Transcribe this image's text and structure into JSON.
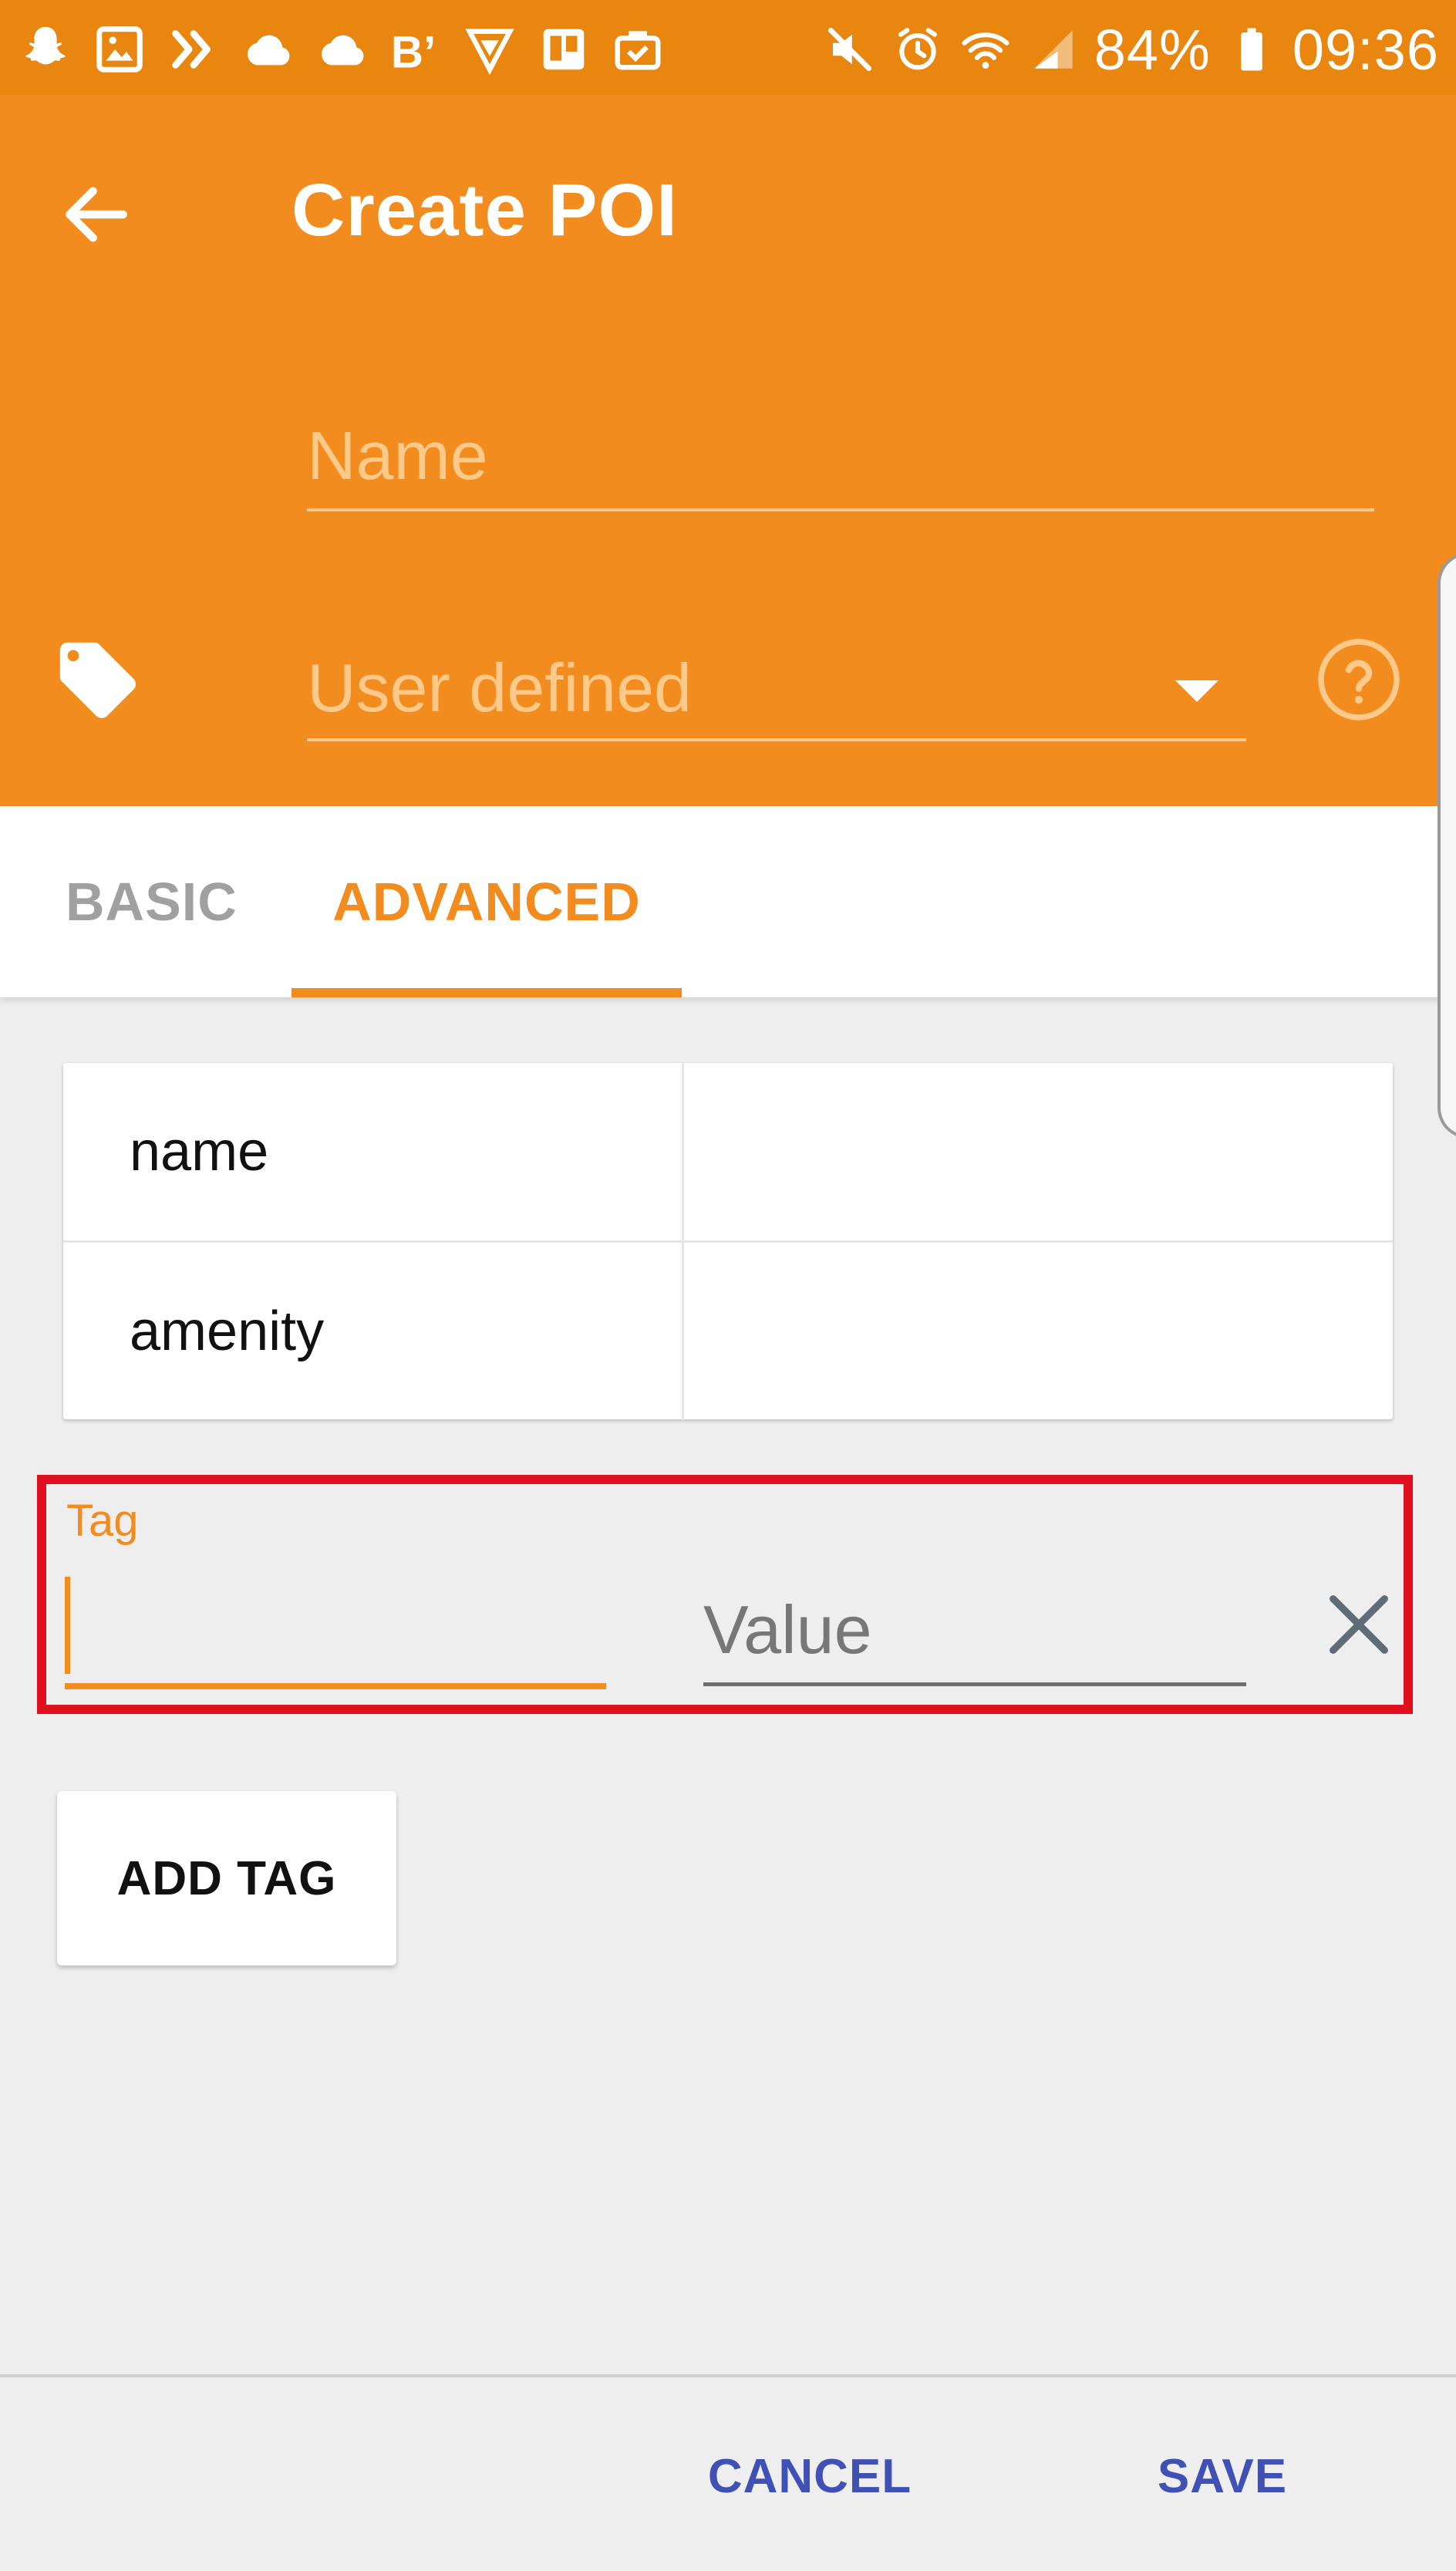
{
  "status_bar": {
    "left_icons": [
      "snapchat-icon",
      "gallery-icon",
      "forward-icon",
      "cloud-icon",
      "cloud-icon",
      "bold-b-icon",
      "triangle-logo-icon",
      "trello-icon",
      "briefcase-icon"
    ],
    "right_icons": [
      "mute-icon",
      "alarm-icon",
      "wifi-icon",
      "signal-icon",
      "battery-icon"
    ],
    "battery_text": "84%",
    "time": "09:36"
  },
  "app_bar": {
    "title": "Create POI",
    "name_placeholder": "Name",
    "type_value": "User defined",
    "back_icon": "arrow-left-icon",
    "tag_icon": "tag-icon",
    "help_icon": "help-circle-icon"
  },
  "tabs": [
    {
      "label": "BASIC",
      "active": false
    },
    {
      "label": "ADVANCED",
      "active": true
    }
  ],
  "tag_table": {
    "rows": [
      {
        "key": "name",
        "value": ""
      },
      {
        "key": "amenity",
        "value": ""
      }
    ]
  },
  "new_tag": {
    "tag_label": "Tag",
    "tag_value": "",
    "value_placeholder": "Value",
    "value_value": ""
  },
  "add_tag_label": "ADD TAG",
  "footer": {
    "cancel_label": "CANCEL",
    "save_label": "SAVE"
  },
  "colors": {
    "status_bar": "#e8860f",
    "app_bar": "#f28c1f",
    "accent": "#f28c1f",
    "highlight": "#e0101e",
    "footer_text": "#3f51b5"
  }
}
